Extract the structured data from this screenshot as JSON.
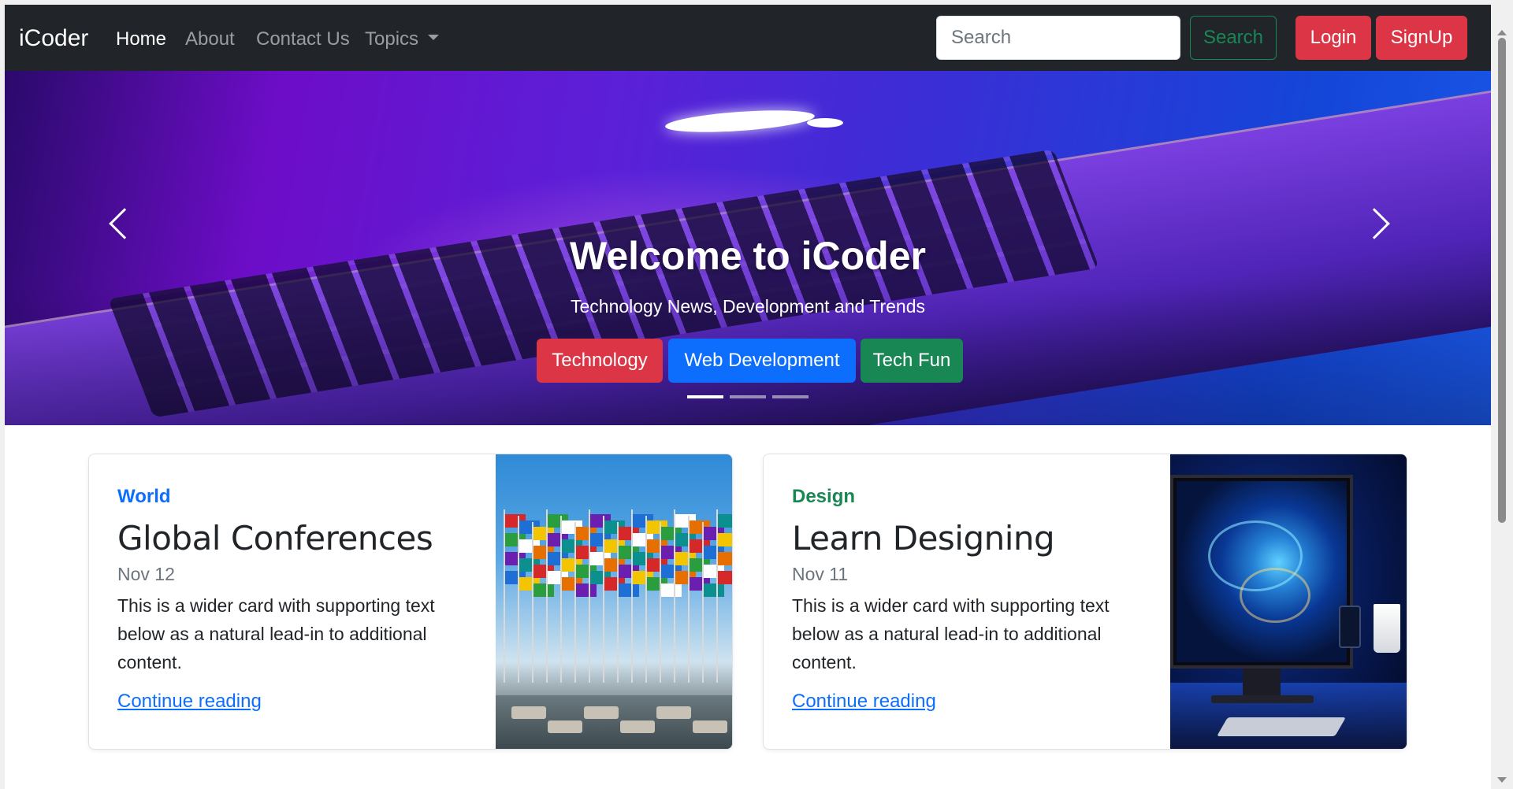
{
  "navbar": {
    "brand": "iCoder",
    "links": [
      {
        "label": "Home",
        "active": true
      },
      {
        "label": "About",
        "active": false
      },
      {
        "label": "Contact Us",
        "active": false
      },
      {
        "label": "Topics",
        "active": false,
        "dropdown": true
      }
    ],
    "search_placeholder": "Search",
    "search_button": "Search",
    "login_button": "Login",
    "signup_button": "SignUp"
  },
  "carousel": {
    "title": "Welcome to iCoder",
    "subtitle": "Technology News, Development and Trends",
    "buttons": [
      {
        "label": "Technology",
        "color": "#dc3545"
      },
      {
        "label": "Web Development",
        "color": "#0d6efd"
      },
      {
        "label": "Tech Fun",
        "color": "#198754"
      }
    ],
    "active_slide": 1,
    "slide_count": 3
  },
  "cards": [
    {
      "category": "World",
      "category_color": "#0d6efd",
      "title": "Global Conferences",
      "date": "Nov 12",
      "text": "This is a wider card with supporting text below as a natural lead-in to additional content.",
      "link": "Continue reading",
      "image": "flags-plaza-image"
    },
    {
      "category": "Design",
      "category_color": "#198754",
      "title": "Learn Designing",
      "date": "Nov 11",
      "text": "This is a wider card with supporting text below as a natural lead-in to additional content.",
      "link": "Continue reading",
      "image": "desk-monitor-image"
    }
  ],
  "icons": {
    "prev": "chevron-left-icon",
    "next": "chevron-right-icon",
    "dropdown": "caret-down-icon"
  },
  "colors": {
    "navbar_bg": "#212529",
    "danger": "#dc3545",
    "primary": "#0d6efd",
    "success": "#198754"
  }
}
